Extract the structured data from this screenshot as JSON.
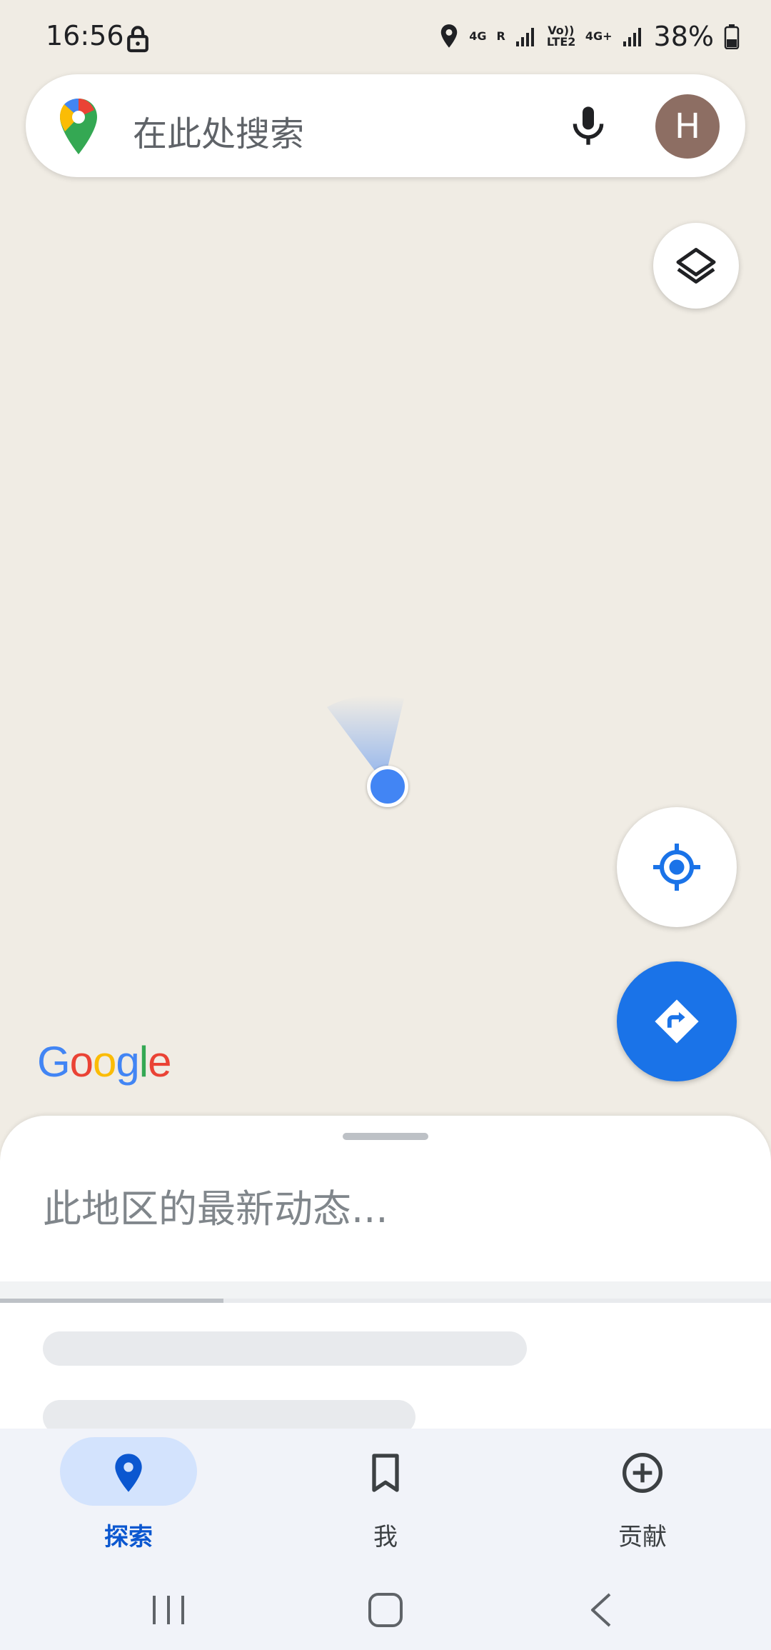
{
  "status_bar": {
    "time": "16:56",
    "network_1": "4G",
    "roaming": "R",
    "volte": "Vo)) LTE2",
    "network_2": "4G+",
    "battery": "38%"
  },
  "search": {
    "placeholder": "在此处搜索",
    "avatar_letter": "H"
  },
  "map": {
    "google_logo": [
      "G",
      "o",
      "o",
      "g",
      "l",
      "e"
    ],
    "google_colors": [
      "#4285f4",
      "#ea4335",
      "#fbbc05",
      "#4285f4",
      "#34a853",
      "#ea4335"
    ]
  },
  "sheet": {
    "title": "此地区的最新动态...",
    "progress_fraction": 0.29
  },
  "nav": {
    "explore": "探索",
    "me": "我",
    "contribute": "贡献"
  },
  "colors": {
    "accent": "#1a73e8",
    "map_bg": "#f0ece4",
    "nav_active": "#0b57d0"
  },
  "icons": [
    "lock-icon",
    "location-icon",
    "signal-icon",
    "battery-icon",
    "maps-logo-icon",
    "mic-icon",
    "layers-icon",
    "my-location-icon",
    "directions-icon",
    "pin-icon",
    "bookmark-icon",
    "add-circle-icon",
    "recents-icon",
    "home-icon",
    "back-icon"
  ]
}
